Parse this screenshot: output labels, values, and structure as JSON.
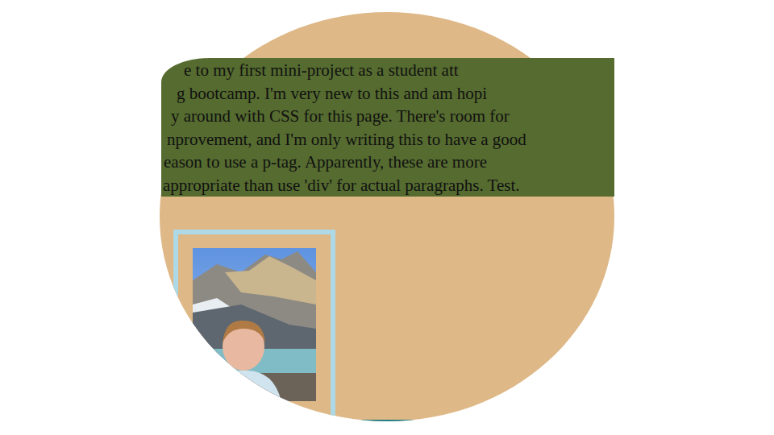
{
  "paragraph": {
    "lines": [
      "e to my first mini-project as a student att",
      "g bootcamp. I'm very new to this and am hopi",
      "y around with CSS for this page. There's room for",
      "nprovement, and I'm only writing this to have a good",
      "eason to use a p-tag. Apparently, these are more",
      "appropriate than use 'div' for actual paragraphs. Test."
    ]
  }
}
